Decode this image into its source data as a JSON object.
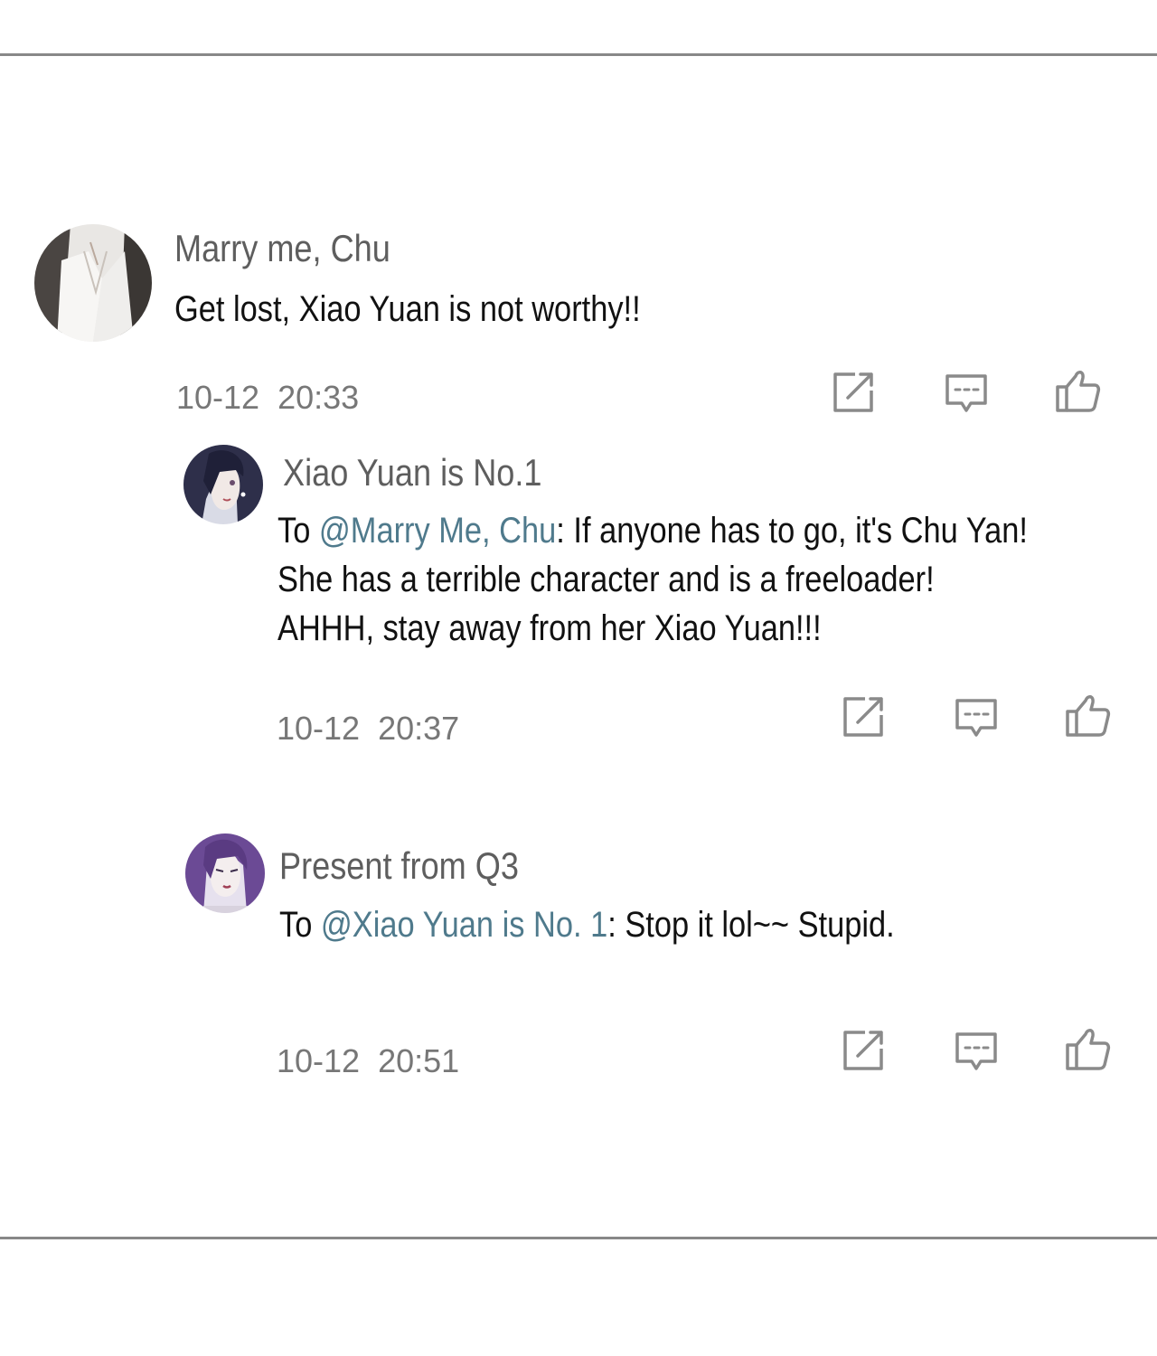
{
  "comments": [
    {
      "username": "Marry me, Chu",
      "text": "Get lost, Xiao Yuan is not worthy!!",
      "timestamp": "10-12  20:33",
      "avatar_icon": "avatar-white-shirt-figure"
    },
    {
      "username": "Xiao Yuan is No.1",
      "reply_prefix": "To ",
      "mention": "@Marry Me, Chu",
      "line1_rest": ": If anyone has to go, it's Chu Yan!",
      "line2": "She has a terrible character and is a freeloader!",
      "line3": "AHHH, stay away from her Xiao Yuan!!!",
      "timestamp": "10-12  20:37",
      "avatar_icon": "avatar-dark-haired-woman"
    },
    {
      "username": "Present from Q3",
      "reply_prefix": "To ",
      "mention": "@Xiao Yuan is No. 1",
      "line1_rest": ": Stop it lol~~ Stupid.",
      "timestamp": "10-12  20:51",
      "avatar_icon": "avatar-purple-haired-woman"
    }
  ],
  "actions": {
    "share_icon": "share-icon",
    "reply_icon": "comment-icon",
    "like_icon": "thumbs-up-icon"
  },
  "colors": {
    "mention": "#4f7a8c",
    "username": "#5e5e5e",
    "text": "#111111",
    "timestamp": "#777777",
    "icon": "#8a8a8a",
    "divider": "#888888"
  }
}
